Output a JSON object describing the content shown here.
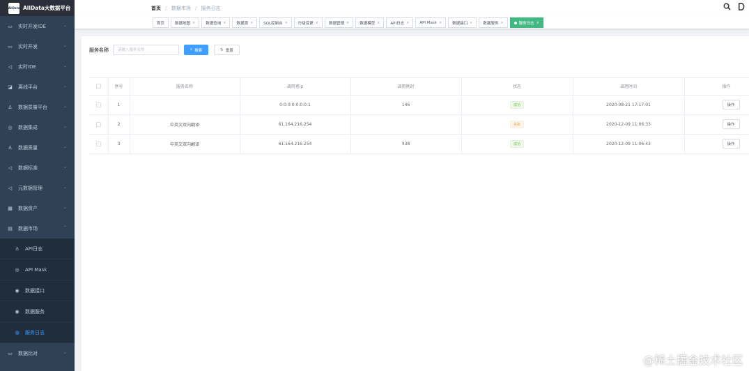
{
  "app": {
    "logo_text": "AllData",
    "title": "AllData大数据平台"
  },
  "sidebar": {
    "items": [
      {
        "label": "实时开发IDE",
        "icon": "▭"
      },
      {
        "label": "实时开发",
        "icon": "▭"
      },
      {
        "label": "实时IDE",
        "icon": "◁"
      },
      {
        "label": "离线平台",
        "icon": "◪"
      },
      {
        "label": "数据质量平台",
        "icon": "♙"
      },
      {
        "label": "数据集成",
        "icon": "◎"
      },
      {
        "label": "数据质量",
        "icon": "♙"
      },
      {
        "label": "数据标准",
        "icon": "◁"
      },
      {
        "label": "元数据管理",
        "icon": "◁"
      },
      {
        "label": "数据资产",
        "icon": "▦"
      },
      {
        "label": "数据市场",
        "icon": "▤"
      }
    ],
    "subitems": [
      {
        "label": "API日志",
        "icon": "♙"
      },
      {
        "label": "API Mask",
        "icon": "◎"
      },
      {
        "label": "数据接口",
        "icon": "◉"
      },
      {
        "label": "数据服务",
        "icon": "◉"
      },
      {
        "label": "服务日志",
        "icon": "◍"
      }
    ],
    "last_item": {
      "label": "数据比对",
      "icon": "▭"
    }
  },
  "navbar": {
    "breadcrumb": [
      "首页",
      "数据市场",
      "服务日志"
    ]
  },
  "tags": [
    {
      "label": "首页",
      "closable": false
    },
    {
      "label": "数据地图",
      "closable": true
    },
    {
      "label": "数据查询",
      "closable": true
    },
    {
      "label": "数据源",
      "closable": true
    },
    {
      "label": "SQL控制台",
      "closable": true
    },
    {
      "label": "行级变更",
      "closable": true
    },
    {
      "label": "数据管理",
      "closable": true
    },
    {
      "label": "数据模型",
      "closable": true
    },
    {
      "label": "API日志",
      "closable": true
    },
    {
      "label": "API Mask",
      "closable": true
    },
    {
      "label": "数据接口",
      "closable": true
    },
    {
      "label": "数据服务",
      "closable": true
    },
    {
      "label": "服务日志",
      "closable": true,
      "active": true
    }
  ],
  "search": {
    "label": "服务名称",
    "placeholder": "请输入服务名称",
    "value": "",
    "search_button": "搜索",
    "reset_button": "重置"
  },
  "table": {
    "columns": [
      "序号",
      "服务名称",
      "调用者ip",
      "调用耗时",
      "状态",
      "调用时间",
      "操作"
    ],
    "rows": [
      {
        "index": "1",
        "name": "",
        "ip": "0:0:0:0:0:0:0:1",
        "duration": "146",
        "status": "成功",
        "status_type": "success",
        "time": "2020-08-21 17:17:01",
        "action": "操作"
      },
      {
        "index": "2",
        "name": "中英文双向翻译",
        "ip": "61.164.216.254",
        "duration": "",
        "status": "失败",
        "status_type": "fail",
        "time": "2020-12-09 11:06:33",
        "action": "操作"
      },
      {
        "index": "3",
        "name": "中英文双向翻译",
        "ip": "61.164.216.254",
        "duration": "438",
        "status": "成功",
        "status_type": "success",
        "time": "2020-12-09 11:06:43",
        "action": "操作"
      }
    ]
  },
  "watermark": "@稀土掘金技术社区",
  "colors": {
    "sidebar_bg": "#304156",
    "primary": "#409eff",
    "active_tag": "#42b983"
  }
}
